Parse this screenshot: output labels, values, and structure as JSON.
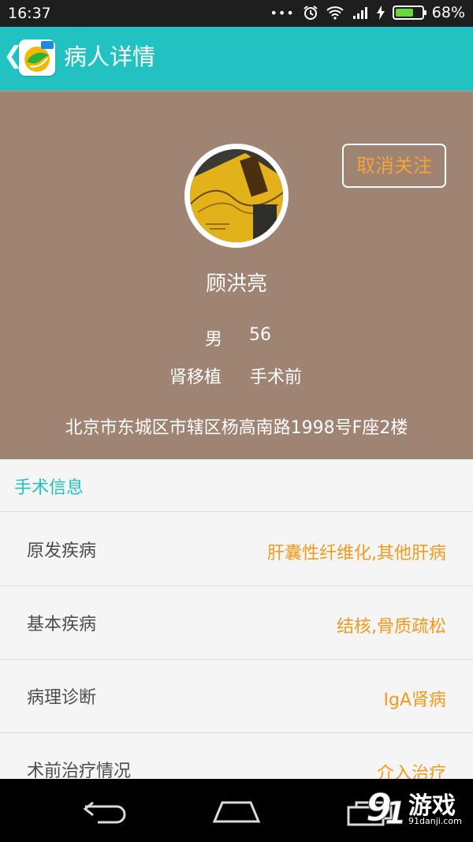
{
  "status_bar": {
    "time": "16:37",
    "battery": "68%",
    "battery_level": 0.68
  },
  "app_bar": {
    "title": "病人详情",
    "back_icon": "chevron-left-icon"
  },
  "patient": {
    "name": "顾洪亮",
    "gender": "男",
    "age": "56",
    "transplant": "肾移植",
    "stage": "手术前",
    "address": "北京市东城区市辖区杨高南路1998号F座2楼",
    "unfollow_label": "取消关注"
  },
  "surgery_info": {
    "title": "手术信息",
    "items": [
      {
        "label": "原发疾病",
        "value": "肝囊性纤维化,其他肝病"
      },
      {
        "label": "基本疾病",
        "value": "结核,骨质疏松"
      },
      {
        "label": "病理诊断",
        "value": "IgA肾病"
      },
      {
        "label": "术前治疗情况",
        "value": "介入治疗"
      }
    ]
  },
  "watermark": {
    "brand": "游戏",
    "url": "91danji.com"
  },
  "colors": {
    "accent": "#21c2c1",
    "hero_bg": "#9f8373",
    "value_orange": "#f39a1c"
  }
}
